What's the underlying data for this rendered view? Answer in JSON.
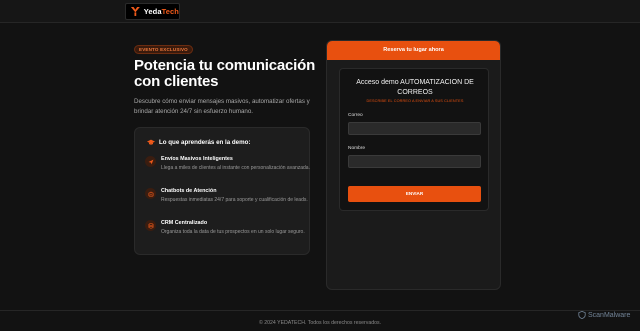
{
  "header": {
    "logo_part1": "Yeda",
    "logo_part2": "Tech"
  },
  "hero": {
    "badge": "EVENTO EXCLUSIVO",
    "headline": "Potencia tu comunicación con clientes",
    "description": "Descubre cómo enviar mensajes masivos, automatizar ofertas y brindar atención 24/7 sin esfuerzo humano."
  },
  "learn": {
    "title": "Lo que aprenderás en la demo:",
    "features": [
      {
        "title": "Envíos Masivos Inteligentes",
        "desc": "Llega a miles de clientes al instante con personalización avanzada.",
        "icon": "send-icon"
      },
      {
        "title": "Chatbots de Atención",
        "desc": "Respuestas inmediatas 24/7 para soporte y cualificación de leads.",
        "icon": "bot-icon"
      },
      {
        "title": "CRM Centralizado",
        "desc": "Organiza toda la data de tus prospectos en un solo lugar seguro.",
        "icon": "database-icon"
      }
    ]
  },
  "form": {
    "header": "Reserva tu lugar ahora",
    "title": "Acceso demo AUTOMATIZACION DE CORREOS",
    "subtitle": "DESCRIBE EL CORREO A ENVIAR A SUS CLIENTES",
    "email_label": "Correo",
    "name_label": "Nombre",
    "submit_label": "ENVIAR"
  },
  "footer": {
    "text": "© 2024 YEDATECH. Todos los derechos reservados."
  },
  "watermark": {
    "text": "ScanMalware"
  },
  "colors": {
    "accent": "#e8500f",
    "background": "#121212",
    "card": "#1d1d1d"
  }
}
